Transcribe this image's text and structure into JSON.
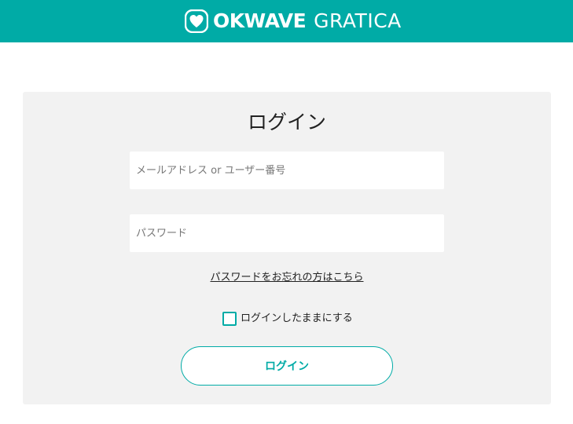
{
  "header": {
    "logo_okwave": "OKWAVE",
    "logo_gratica": "GRATICA",
    "accent_color": "#00ABA6",
    "logo_icon": "heart-icon"
  },
  "login": {
    "title": "ログイン",
    "email_placeholder": "メールアドレス or ユーザー番号",
    "password_placeholder": "パスワード",
    "forgot_link": "パスワードをお忘れの方はこちら",
    "remember_label": "ログインしたままにする",
    "remember_checked": false,
    "submit_label": "ログイン"
  }
}
